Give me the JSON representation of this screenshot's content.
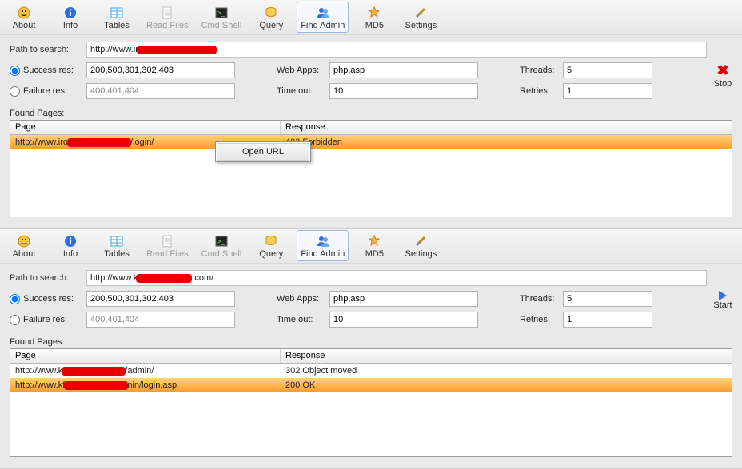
{
  "toolbar": {
    "about": "About",
    "info": "Info",
    "tables": "Tables",
    "readfiles": "Read Files",
    "cmdshell": "Cmd Shell",
    "query": "Query",
    "findadmin": "Find Admin",
    "md5": "MD5",
    "settings": "Settings"
  },
  "labels": {
    "path": "Path to search:",
    "success": "Success res:",
    "failure": "Failure res:",
    "webapps": "Web Apps:",
    "timeout": "Time out:",
    "threads": "Threads:",
    "retries": "Retries:",
    "found": "Found Pages:",
    "colPage": "Page",
    "colResp": "Response"
  },
  "ctx": {
    "open": "Open URL"
  },
  "top": {
    "action": "Stop",
    "path_prefix": "http://www.ir",
    "success": "200,500,301,302,403",
    "failure": "400,401,404",
    "webapps": "php,asp",
    "timeout": "10",
    "threads": "5",
    "retries": "1",
    "rows": [
      {
        "page_prefix": "http://www.iro",
        "page_suffix": "/login/",
        "response": "403 Forbidden",
        "selected": true
      }
    ]
  },
  "bottom": {
    "action": "Start",
    "path_prefix": "http://www.k",
    "path_suffix": ".com/",
    "success": "200,500,301,302,403",
    "failure": "400,401,404",
    "webapps": "php,asp",
    "timeout": "10",
    "threads": "5",
    "retries": "1",
    "rows": [
      {
        "page_prefix": "http://www.k",
        "page_suffix": "/admin/",
        "response": "302 Object moved",
        "selected": false
      },
      {
        "page_prefix": "http://www.kf",
        "page_suffix": "nin/login.asp",
        "response": "200 OK",
        "selected": true
      }
    ]
  }
}
